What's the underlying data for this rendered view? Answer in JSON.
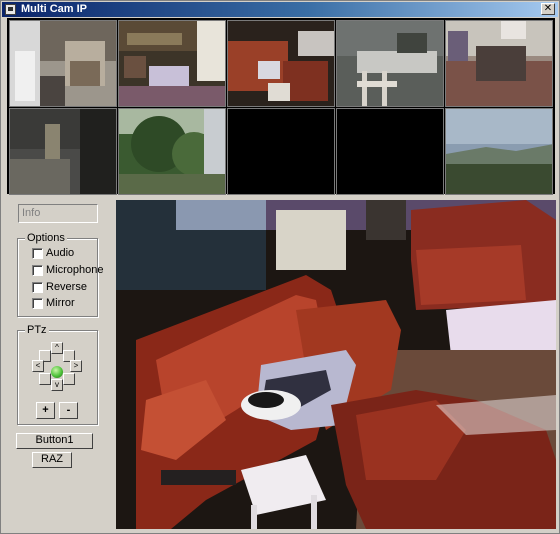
{
  "window": {
    "title": "Multi Cam IP",
    "close_glyph": "✕"
  },
  "info": {
    "text": "Info"
  },
  "options": {
    "label": "Options",
    "items": [
      {
        "label": "Audio",
        "checked": false
      },
      {
        "label": "Microphone",
        "checked": false
      },
      {
        "label": "Reverse",
        "checked": false
      },
      {
        "label": "Mirror",
        "checked": false
      }
    ]
  },
  "ptz": {
    "label": "PTz",
    "up": "^",
    "down": "v",
    "left": "<",
    "right": ">",
    "plus": "+",
    "minus": "-"
  },
  "buttons": {
    "button1": "Button1",
    "raz": "RAZ"
  },
  "cameras": [
    {
      "id": "cam-1",
      "active": true
    },
    {
      "id": "cam-2",
      "active": true
    },
    {
      "id": "cam-3",
      "active": true
    },
    {
      "id": "cam-4",
      "active": true
    },
    {
      "id": "cam-5",
      "active": true
    },
    {
      "id": "cam-6",
      "active": true
    },
    {
      "id": "cam-7",
      "active": true
    },
    {
      "id": "cam-8",
      "active": false
    },
    {
      "id": "cam-9",
      "active": false
    },
    {
      "id": "cam-10",
      "active": true
    }
  ],
  "colors": {
    "title_start": "#0a246a",
    "title_end": "#a6caf0",
    "window_bg": "#d4d0c8",
    "ptz_green": "#4ec23a"
  }
}
